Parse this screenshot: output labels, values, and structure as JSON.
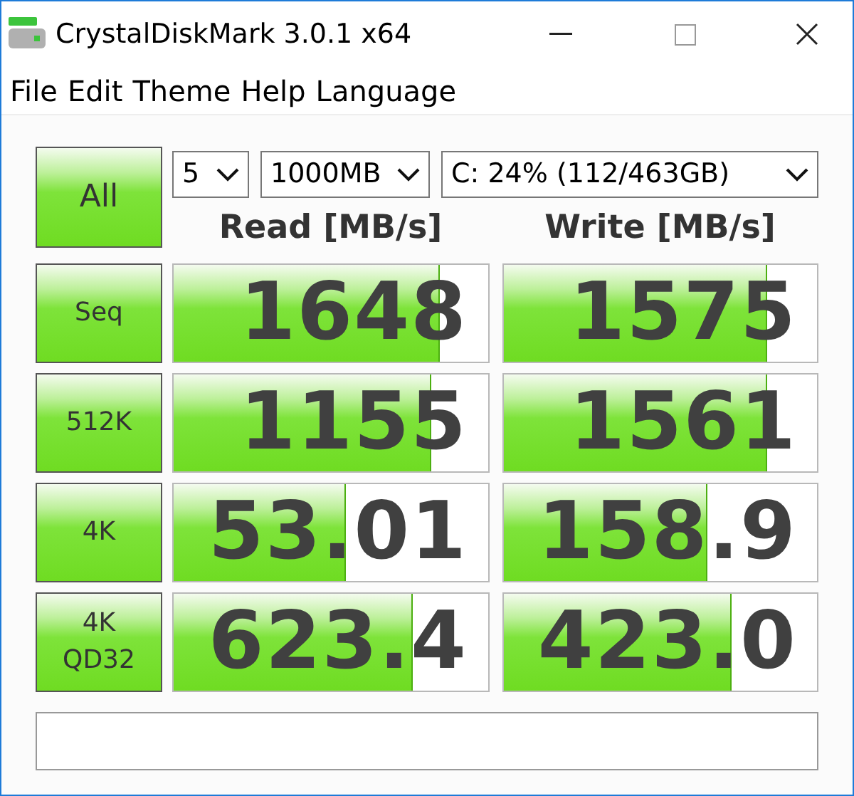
{
  "window": {
    "title": "CrystalDiskMark 3.0.1 x64"
  },
  "menu": [
    "File",
    "Edit",
    "Theme",
    "Help",
    "Language"
  ],
  "all_button": "All",
  "selects": [
    {
      "value": "5"
    },
    {
      "value": "1000MB"
    },
    {
      "value": "C: 24% (112/463GB)"
    }
  ],
  "columns": [
    "Read [MB/s]",
    "Write [MB/s]"
  ],
  "rows": [
    {
      "label": "Seq",
      "read": {
        "value": "1648",
        "level": 0.85
      },
      "write": {
        "value": "1575",
        "level": 0.84
      }
    },
    {
      "label": "512K",
      "read": {
        "value": "1155",
        "level": 0.82
      },
      "write": {
        "value": "1561",
        "level": 0.84
      }
    },
    {
      "label": "4K",
      "read": {
        "value": "53.01",
        "level": 0.55
      },
      "write": {
        "value": "158.9",
        "level": 0.65
      }
    },
    {
      "label": "4K\nQD32",
      "read": {
        "value": "623.4",
        "level": 0.76
      },
      "write": {
        "value": "423.0",
        "level": 0.73
      }
    }
  ]
}
